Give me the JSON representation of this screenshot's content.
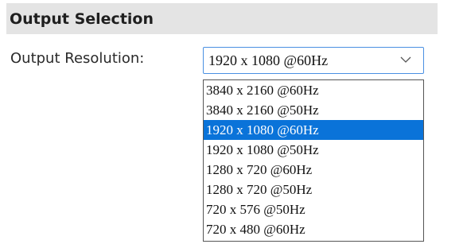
{
  "section": {
    "title": "Output Selection"
  },
  "output_resolution": {
    "label": "Output Resolution:",
    "selected_value": "1920 x 1080 @60Hz",
    "options": [
      {
        "label": "3840 x 2160 @60Hz"
      },
      {
        "label": "3840 x 2160 @50Hz"
      },
      {
        "label": "1920 x 1080 @60Hz",
        "selected": true
      },
      {
        "label": "1920 x 1080 @50Hz"
      },
      {
        "label": "1280 x 720 @60Hz"
      },
      {
        "label": "1280 x 720 @50Hz"
      },
      {
        "label": "720 x 576 @50Hz"
      },
      {
        "label": "720 x 480 @60Hz"
      }
    ]
  },
  "icons": {
    "dropdown_arrow": "chevron-down-icon"
  },
  "colors": {
    "header_background": "#e4e4e4",
    "select_border": "#4a90e2",
    "highlight": "#0a73d9"
  }
}
